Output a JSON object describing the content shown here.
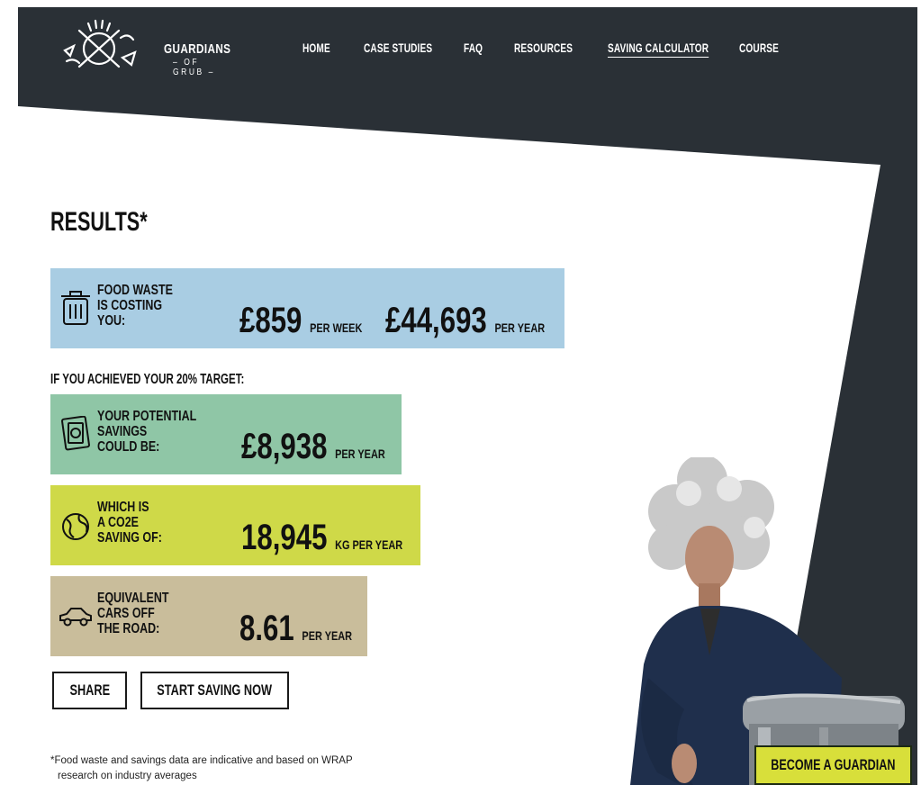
{
  "brand": {
    "name": "GUARDIANS",
    "sub": "– OF GRUB –"
  },
  "nav": [
    {
      "label": "HOME"
    },
    {
      "label": "CASE STUDIES"
    },
    {
      "label": "FAQ"
    },
    {
      "label": "RESOURCES"
    },
    {
      "label": "SAVING CALCULATOR",
      "active": true
    },
    {
      "label": "COURSE"
    }
  ],
  "results": {
    "title": "RESULTS*",
    "costing": {
      "label_1": "FOOD WASTE",
      "label_2": "IS COSTING",
      "label_3": "YOU:",
      "week_value": "£859",
      "week_unit": "PER WEEK",
      "year_value": "£44,693",
      "year_unit": "PER YEAR",
      "color": "#a9cde3"
    },
    "target_label": "IF YOU ACHIEVED YOUR 20% TARGET:",
    "savings": {
      "label_1": "YOUR POTENTIAL",
      "label_2": "SAVINGS",
      "label_3": "COULD BE:",
      "value": "£8,938",
      "unit": "PER YEAR",
      "color": "#8fc6a6"
    },
    "co2": {
      "label_1": "WHICH IS",
      "label_2": "A CO2E",
      "label_3": "SAVING OF:",
      "value": "18,945",
      "unit": "KG PER YEAR",
      "color": "#cfd948"
    },
    "cars": {
      "label_1": "EQUIVALENT",
      "label_2": "CARS OFF",
      "label_3": "THE ROAD:",
      "value": "8.61",
      "unit": "PER YEAR",
      "color": "#c9bd9b"
    }
  },
  "buttons": {
    "share": "SHARE",
    "start": "START SAVING NOW",
    "guardian": "BECOME A GUARDIAN"
  },
  "footnote": {
    "line_1": "*Food waste and savings data are indicative and based on WRAP",
    "line_2": "research on industry averages"
  },
  "colors": {
    "header_bg": "#2a3036",
    "guardian_btn": "#d8df3a"
  }
}
